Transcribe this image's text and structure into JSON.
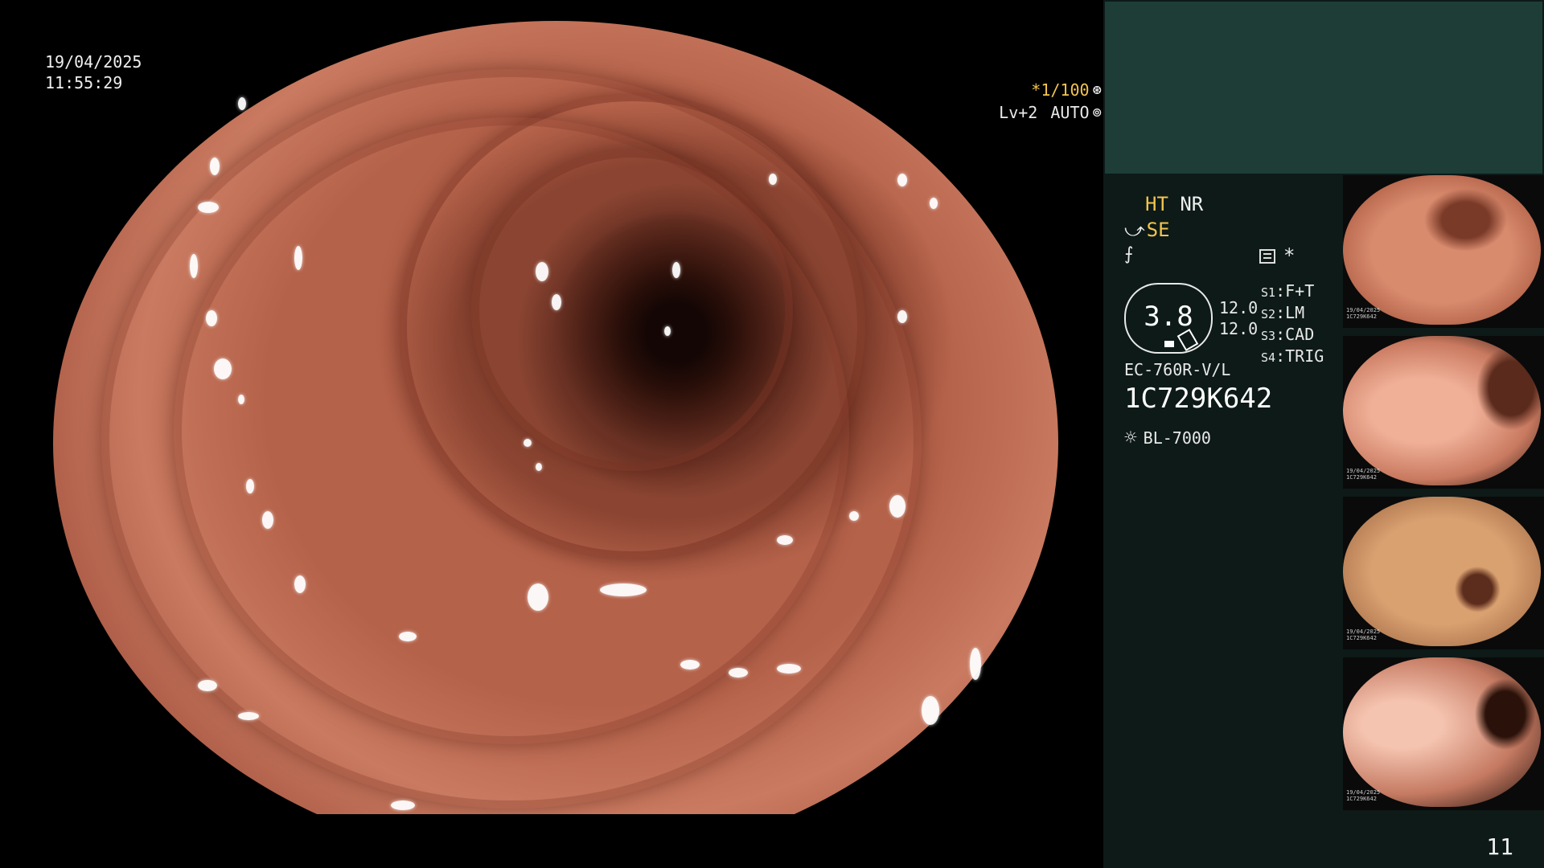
{
  "overlay": {
    "date": "19/04/2025",
    "time": "11:55:29",
    "shutter_speed": "*1/100",
    "shutter_icon": "aperture-icon",
    "enhancement": "Lv+2",
    "iris_mode": "AUTO",
    "iris_icon": "iris-icon"
  },
  "panel": {
    "mode_primary": "HT",
    "mode_secondary": "NR",
    "se_label": "SE",
    "structure_icon": "structure-enhancement-icon",
    "star": "*",
    "zoom_value": "3.8",
    "scale_values": [
      "12.0",
      "12.0"
    ],
    "switches": [
      {
        "key": "S1",
        "value": "F+T"
      },
      {
        "key": "S2",
        "value": "LM"
      },
      {
        "key": "S3",
        "value": "CAD"
      },
      {
        "key": "S4",
        "value": "TRIG"
      }
    ],
    "scope_model": "EC-760R-V/L",
    "serial_number": "1C729K642",
    "light_source": "BL-7000",
    "page_number": "11"
  },
  "thumbnails": [
    {
      "label_top": "19/04/2025",
      "label_serial": "1C729K642"
    },
    {
      "label_top": "19/04/2025",
      "label_serial": "1C729K642"
    },
    {
      "label_top": "19/04/2025",
      "label_serial": "1C729K642"
    },
    {
      "label_top": "19/04/2025",
      "label_serial": "1C729K642"
    }
  ]
}
